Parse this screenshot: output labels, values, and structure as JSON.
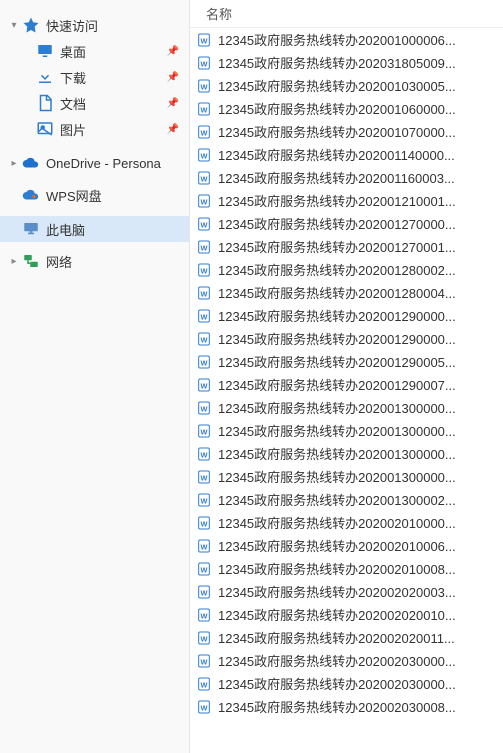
{
  "sidebar": {
    "quickaccess": {
      "label": "快速访问"
    },
    "desktop": {
      "label": "桌面"
    },
    "downloads": {
      "label": "下载"
    },
    "documents": {
      "label": "文档"
    },
    "pictures": {
      "label": "图片"
    },
    "onedrive": {
      "label": "OneDrive - Persona"
    },
    "wps": {
      "label": "WPS网盘"
    },
    "thispc": {
      "label": "此电脑"
    },
    "network": {
      "label": "网络"
    }
  },
  "colors": {
    "accent": "#2f7dd1",
    "selected_bg": "#d9e8f9"
  },
  "main": {
    "column_header": "名称",
    "file_prefix": "12345政府服务热线转办",
    "file_suffix": "...",
    "files": [
      "202001000006",
      "202031805009",
      "202001030005",
      "202001060000",
      "202001070000",
      "202001140000",
      "202001160003",
      "202001210001",
      "202001270000",
      "202001270001",
      "202001280002",
      "202001280004",
      "202001290000",
      "202001290000",
      "202001290005",
      "202001290007",
      "202001300000",
      "202001300000",
      "202001300000",
      "202001300000",
      "202001300002",
      "202002010000",
      "202002010006",
      "202002010008",
      "202002020003",
      "202002020010",
      "202002020011",
      "202002030000",
      "202002030000",
      "202002030008"
    ]
  }
}
